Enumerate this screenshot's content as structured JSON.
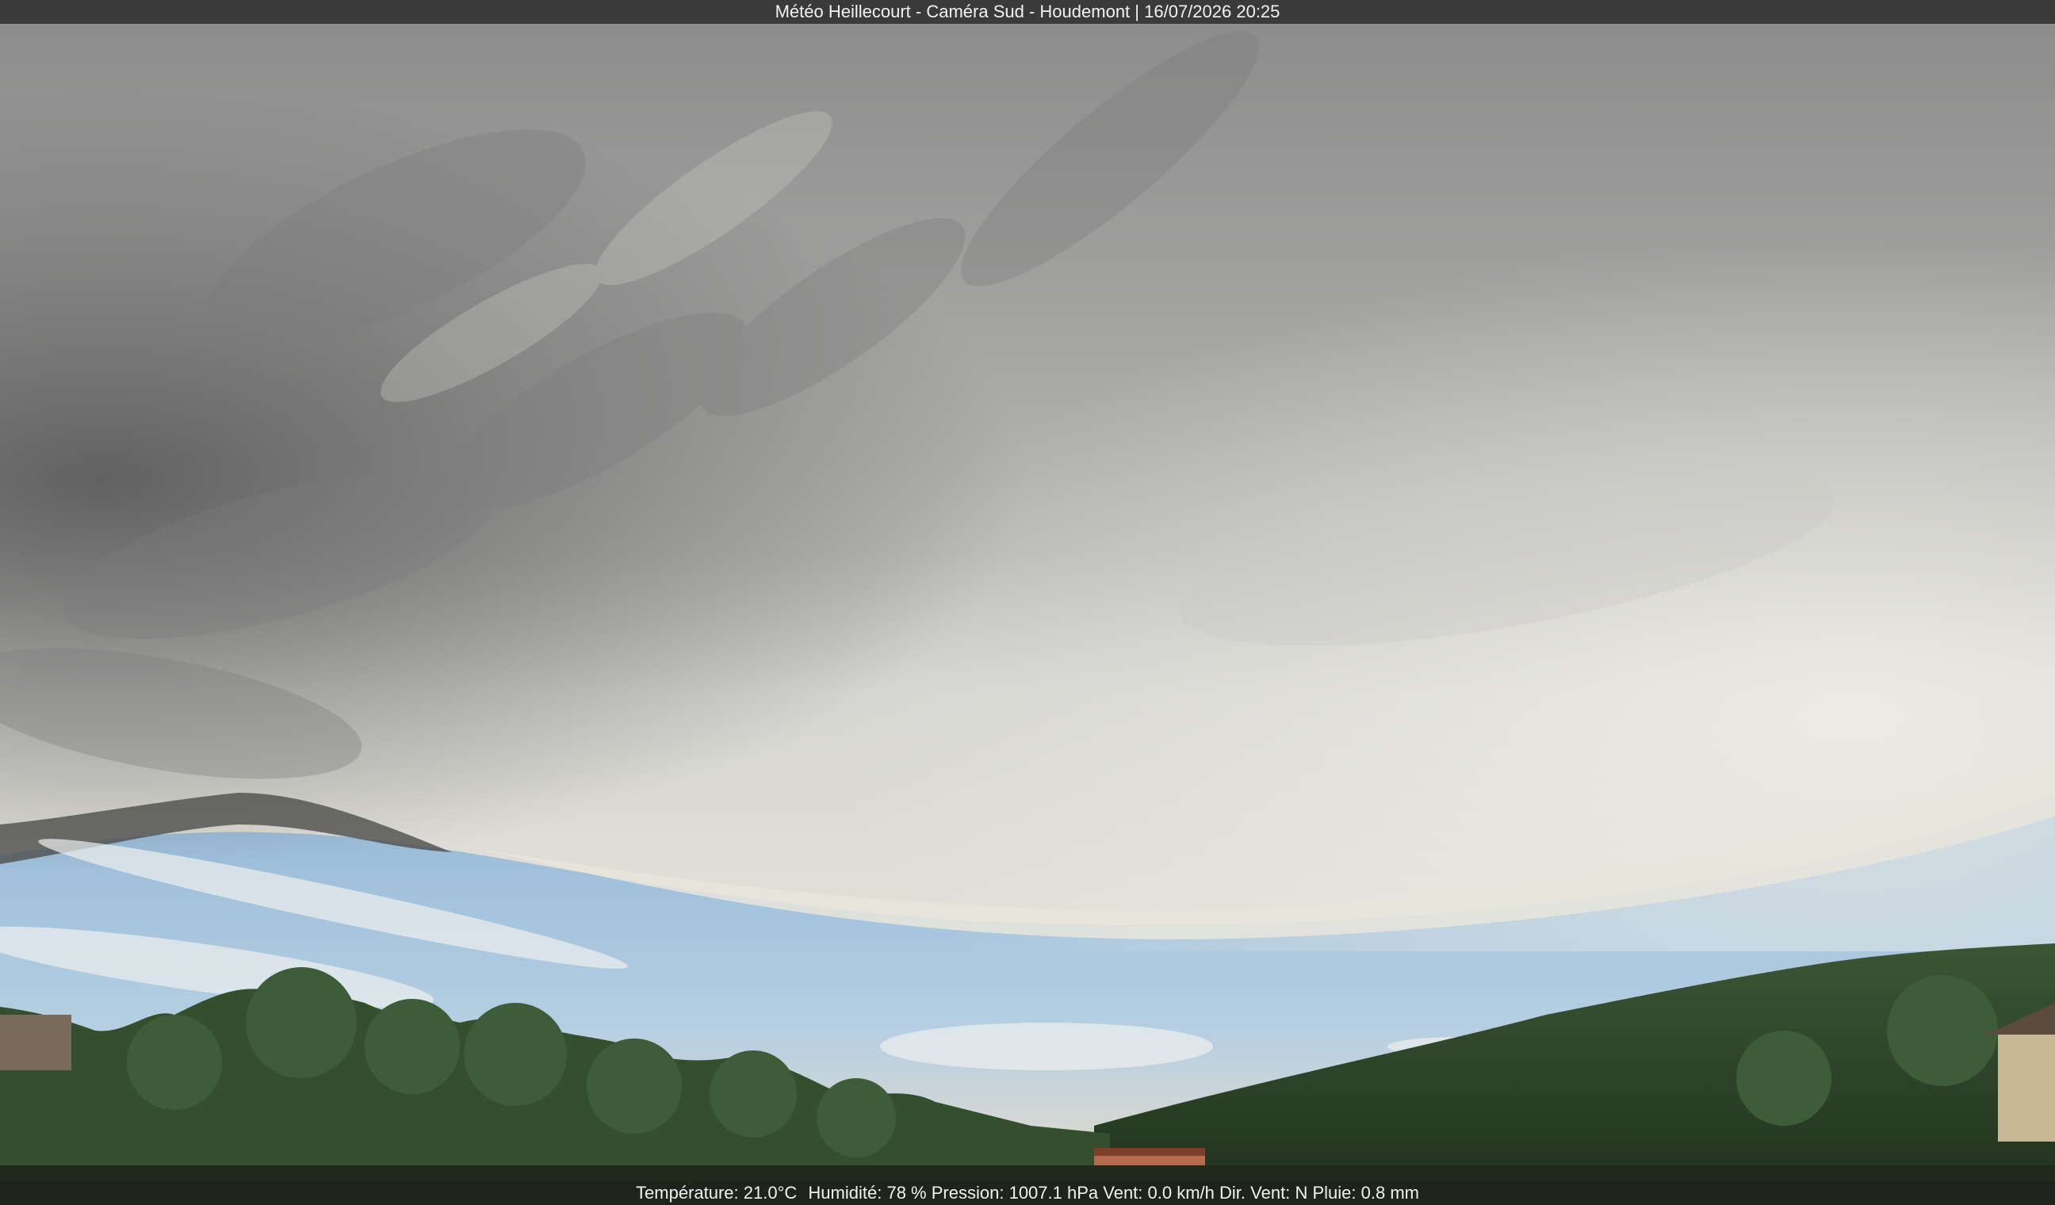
{
  "header": {
    "station": "Météo Heillecourt",
    "camera": "Caméra Sud",
    "location": "Houdemont",
    "datetime": "16/07/2026 20:25"
  },
  "weather": {
    "temperature_label": "Température:",
    "temperature_value": "21.0°C",
    "humidity_label": "Humidité:",
    "humidity_value": "78 %",
    "pressure_label": "Pression:",
    "pressure_value": "1007.1 hPa",
    "wind_label": "Vent:",
    "wind_value": "0.0 km/h",
    "wind_dir_label": "Dir. Vent:",
    "wind_dir_value": "N",
    "rain_label": "Pluie:",
    "rain_value": "0.8 mm"
  },
  "colors": {
    "cloud_dark": "#6f706f",
    "cloud_mid": "#9a9b9a",
    "cloud_light": "#cfd0cc",
    "sky_blue": "#8fb8d8",
    "hill_green": "#2f4a2c",
    "tree_green": "#3c5a35"
  }
}
